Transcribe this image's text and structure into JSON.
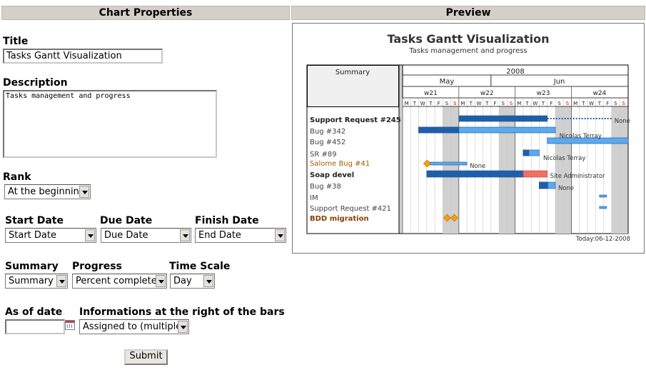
{
  "headers": {
    "properties": "Chart Properties",
    "preview": "Preview"
  },
  "form": {
    "title_label": "Title",
    "title_value": "Tasks Gantt Visualization",
    "description_label": "Description",
    "description_value": "Tasks management and progress",
    "rank_label": "Rank",
    "rank_value": "At the beginning",
    "start_date_label": "Start Date",
    "start_date_value": "Start Date",
    "due_date_label": "Due Date",
    "due_date_value": "Due Date",
    "finish_date_label": "Finish Date",
    "finish_date_value": "End Date",
    "summary_label": "Summary",
    "summary_value": "Summary",
    "progress_label": "Progress",
    "progress_value": "Percent complete",
    "time_scale_label": "Time Scale",
    "time_scale_value": "Day",
    "as_of_label": "As of date",
    "as_of_value": "",
    "info_label": "Informations at the right of the bars",
    "info_value": "Assigned to (multiple)",
    "submit_label": "Submit"
  },
  "gantt": {
    "title": "Tasks Gantt Visualization",
    "subtitle": "Tasks management and progress",
    "summary_header": "Summary",
    "year": "2008",
    "months": [
      "May",
      "Jun"
    ],
    "weeks": [
      "w21",
      "w22",
      "w23",
      "w24"
    ],
    "day_letters": [
      "M",
      "T",
      "W",
      "T",
      "F",
      "S",
      "S",
      "M",
      "T",
      "W",
      "T",
      "F",
      "S",
      "S",
      "M",
      "T",
      "W",
      "T",
      "F",
      "S",
      "S",
      "M",
      "T",
      "W",
      "T",
      "F",
      "S",
      "S"
    ],
    "tasks": [
      {
        "name": "Support Request #245",
        "bold": true,
        "color": "#222222",
        "right_text": "None"
      },
      {
        "name": "Bug #342",
        "bold": false,
        "color": "#444444",
        "right_text": "Nicolas Terray"
      },
      {
        "name": "Bug #452",
        "bold": false,
        "color": "#444444",
        "right_text": ""
      },
      {
        "name": "SR #89",
        "bold": false,
        "color": "#444444",
        "right_text": "Nicolas Terray"
      },
      {
        "name": "Salome Bug #41",
        "bold": false,
        "color": "#a65c00",
        "right_text": "None"
      },
      {
        "name": "Soap devel",
        "bold": true,
        "color": "#222222",
        "right_text": "Site Administrator"
      },
      {
        "name": "Bug #38",
        "bold": false,
        "color": "#444444",
        "right_text": "None"
      },
      {
        "name": "IM",
        "bold": false,
        "color": "#444444",
        "right_text": ""
      },
      {
        "name": "Support Request #421",
        "bold": false,
        "color": "#444444",
        "right_text": ""
      },
      {
        "name": "BDD migration",
        "bold": true,
        "color": "#8a3e00",
        "right_text": ""
      }
    ],
    "today_label": "Today:06-12-2008",
    "colors": {
      "bar_light": "#5aaaf0",
      "bar_dark": "#1f5faa",
      "bar_late": "#f07060",
      "milestone": "#f5a000",
      "weekend": "#d0d0d0"
    }
  }
}
